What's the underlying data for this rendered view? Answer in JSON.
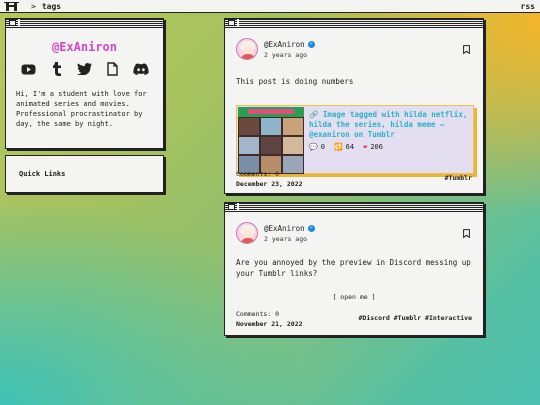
{
  "topbar": {
    "separator": ">",
    "crumb": "tags",
    "rss": "rss"
  },
  "profile": {
    "name": "@ExAniron",
    "socials": [
      "youtube-icon",
      "tumblr-icon",
      "twitter-icon",
      "file-icon",
      "discord-icon"
    ],
    "bio": "Hi, I'm a student with love for animated series and movies. Professional procrastinator by day, the same by night."
  },
  "quick_links": {
    "label": "Quick Links"
  },
  "posts": [
    {
      "user": "@ExAniron",
      "ago": "2 years ago",
      "text": "This post is doing numbers",
      "embed": {
        "title": "🔗 Image tagged with hilda netflix, hilda the series, hilda meme – @exaniron on Tumblr",
        "comments": "0",
        "reblogs": "64",
        "likes": "206"
      },
      "comments_label": "Comments: 0",
      "date": "December 23, 2022",
      "tags": "#Tumblr"
    },
    {
      "user": "@ExAniron",
      "ago": "2 years ago",
      "text": "Are you annoyed by the preview in Discord messing up your Tumblr links?",
      "open_more": "[ open me ]",
      "comments_label": "Comments: 0",
      "date": "November 21, 2022",
      "tags": "#Discord #Tumblr #Interactive"
    }
  ],
  "colors": {
    "accent_name": "#d946c6",
    "link": "#2bb0c9",
    "verified": "#1d8ce0"
  }
}
